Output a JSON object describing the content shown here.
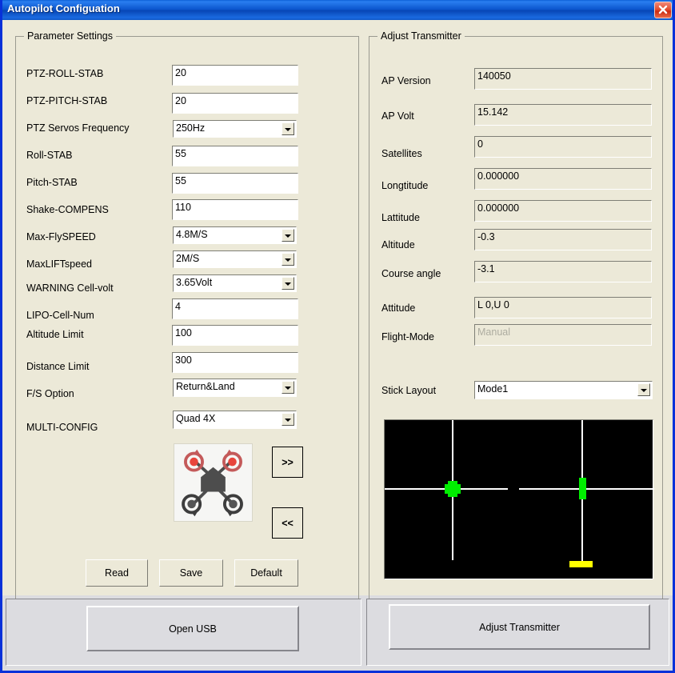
{
  "window": {
    "title": "Autopilot Configuation",
    "close_icon": "close-icon",
    "titlebar_color": "#0a54cc",
    "face_color": "#ece9d8",
    "panel_color": "#dcdce0"
  },
  "parameter_settings": {
    "legend": "Parameter Settings",
    "rows": [
      {
        "label": "PTZ-ROLL-STAB",
        "type": "text",
        "value": "20"
      },
      {
        "label": "PTZ-PITCH-STAB",
        "type": "text",
        "value": "20"
      },
      {
        "label": "PTZ Servos  Frequency",
        "type": "combo",
        "value": "250Hz"
      },
      {
        "label": "Roll-STAB",
        "type": "text",
        "value": "55"
      },
      {
        "label": "Pitch-STAB",
        "type": "text",
        "value": "55"
      },
      {
        "label": "Shake-COMPENS",
        "type": "text",
        "value": "110"
      },
      {
        "label": "Max-FlySPEED",
        "type": "combo",
        "value": "4.8M/S"
      },
      {
        "label": "MaxLIFTspeed",
        "type": "combo",
        "value": "2M/S"
      },
      {
        "label": "WARNING Cell-volt",
        "type": "combo",
        "value": "3.65Volt"
      },
      {
        "label": "LIPO-Cell-Num",
        "type": "text",
        "value": "4"
      },
      {
        "label": "Altitude Limit",
        "type": "text",
        "value": "100"
      },
      {
        "label": "Distance Limit",
        "type": "text",
        "value": "300"
      },
      {
        "label": "F/S Option",
        "type": "combo",
        "value": "Return&Land"
      },
      {
        "label": "MULTI-CONFIG",
        "type": "combo",
        "value": "Quad 4X"
      }
    ],
    "frame_picture": "quadcopter-quad-4x-diagram",
    "next_button": ">>",
    "prev_button": "<<",
    "read_button": "Read",
    "save_button": "Save",
    "default_button": "Default"
  },
  "adjust_transmitter": {
    "legend": "Adjust Transmitter",
    "rows": [
      {
        "label": "AP Version",
        "value": "140050",
        "disabled": false
      },
      {
        "label": "AP Volt",
        "value": "15.142",
        "disabled": false
      },
      {
        "label": "Satellites",
        "value": "0",
        "disabled": false
      },
      {
        "label": "Longtitude",
        "value": "0.000000",
        "disabled": false
      },
      {
        "label": "Lattitude",
        "value": "0.000000",
        "disabled": false
      },
      {
        "label": "Altitude",
        "value": "-0.3",
        "disabled": false
      },
      {
        "label": "Course angle",
        "value": "-3.1",
        "disabled": false
      },
      {
        "label": "Attitude",
        "value": "L 0,U 0",
        "disabled": false
      },
      {
        "label": "Flight-Mode",
        "value": "Manual",
        "disabled": true
      }
    ],
    "stick_layout_label": "Stick Layout",
    "stick_layout_value": "Mode1",
    "stick_display": {
      "background": "#000000",
      "line_color": "#ffffff",
      "cursor_color": "#00ee00",
      "bar_color": "#ffff00",
      "left_stick": {
        "x_pct": 30,
        "y_pct": 50
      },
      "right_stick": {
        "x_pct": 77,
        "y_pct": 50
      },
      "throttle_bar": {
        "x_pct": 77,
        "y_pct": 93
      }
    }
  },
  "footer": {
    "open_usb_button": "Open USB",
    "adjust_transmitter_button": "Adjust Transmitter"
  }
}
